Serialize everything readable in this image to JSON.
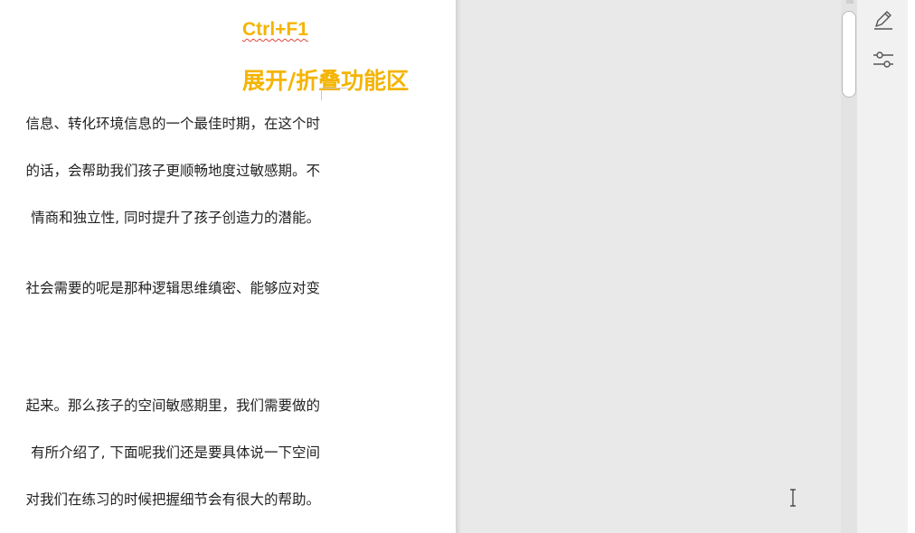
{
  "overlay": {
    "shortcut": "Ctrl+F1",
    "caption": "展开/折叠功能区"
  },
  "document": {
    "lines": [
      "信息、转化环境信息的一个最佳时期，在这个时",
      "的话，会帮助我们孩子更顺畅地度过敏感期。不",
      "情商和独立性, 同时提升了孩子创造力的潜能。",
      "社会需要的呢是那种逻辑思维缜密、能够应对变",
      "起来。那么孩子的空间敏感期里，我们需要做的",
      "有所介绍了, 下面呢我们还是要具体说一下空间",
      "对我们在练习的时候把握细节会有很大的帮助。"
    ]
  },
  "side_panel": {
    "icons": [
      "pen-edit-icon",
      "adjust-sliders-icon"
    ]
  },
  "colors": {
    "overlay_text": "#f4b400",
    "spellcheck_underline": "#e0463a",
    "page_background": "#ffffff",
    "canvas_background": "#e9e9e9"
  }
}
